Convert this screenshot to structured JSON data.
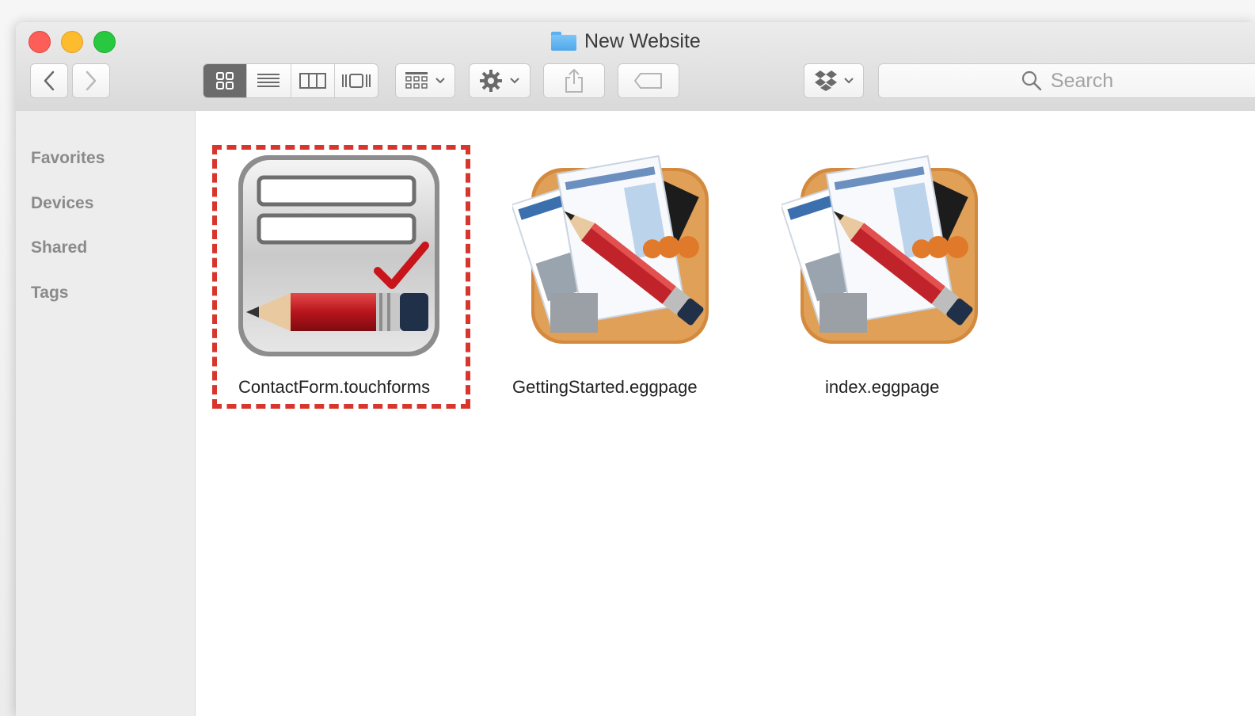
{
  "window": {
    "title": "New Website"
  },
  "toolbar": {
    "back_icon": "chevron-left-icon",
    "forward_icon": "chevron-right-icon",
    "view_modes": [
      "icon-view",
      "list-view",
      "column-view",
      "cover-flow-view"
    ],
    "active_view": "icon-view",
    "arrange_icon": "arrange-grid-icon",
    "action_icon": "gear-icon",
    "share_icon": "share-icon",
    "tag_icon": "tag-icon",
    "dropbox_icon": "dropbox-icon",
    "search_placeholder": "Search"
  },
  "sidebar": {
    "items": [
      {
        "label": "Favorites"
      },
      {
        "label": "Devices"
      },
      {
        "label": "Shared"
      },
      {
        "label": "Tags"
      }
    ]
  },
  "files": [
    {
      "name": "ContactForm.touchforms",
      "icon": "touchforms-document-icon",
      "selected": true
    },
    {
      "name": "GettingStarted.eggpage",
      "icon": "eggpage-document-icon",
      "selected": false
    },
    {
      "name": "index.eggpage",
      "icon": "eggpage-document-icon",
      "selected": false
    }
  ],
  "colors": {
    "highlight_dashed_border": "#d8362c",
    "traffic_close": "#fd5e57",
    "traffic_minimize": "#fdbb2e",
    "traffic_maximize": "#28c840"
  }
}
